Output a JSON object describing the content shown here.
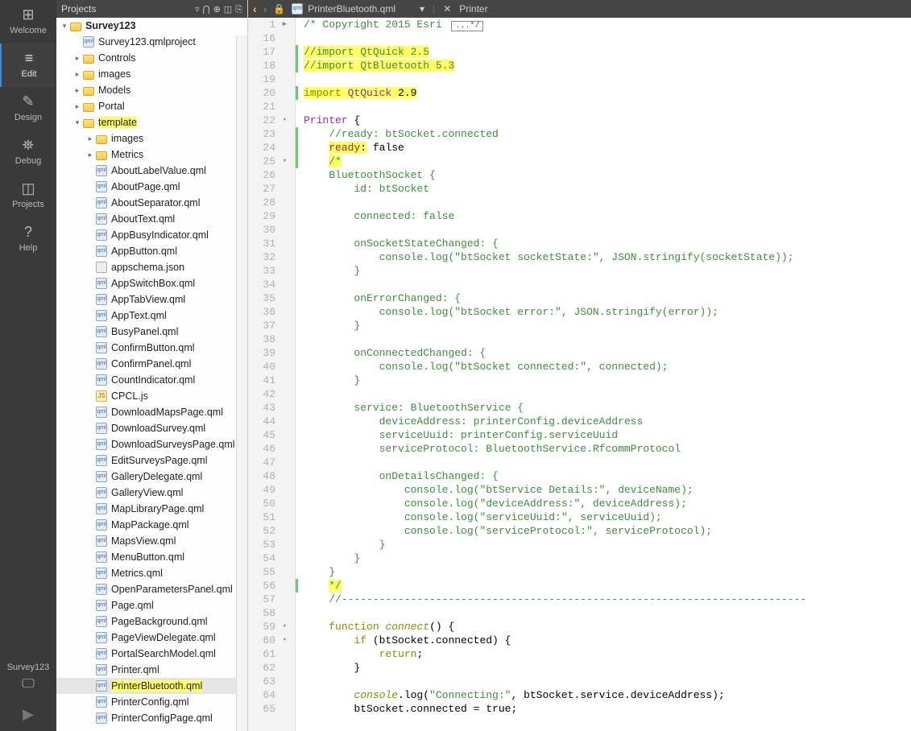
{
  "rail": {
    "items": [
      {
        "icon": "⊞",
        "label": "Welcome"
      },
      {
        "icon": "≡",
        "label": "Edit"
      },
      {
        "icon": "✎",
        "label": "Design"
      },
      {
        "icon": "⛯",
        "label": "Debug"
      },
      {
        "icon": "◫",
        "label": "Projects"
      },
      {
        "icon": "?",
        "label": "Help"
      }
    ],
    "bottom_label": "Survey123",
    "monitor_icon": "🖵",
    "play_icon": "▶"
  },
  "panel": {
    "title": "Projects",
    "toolbar_icons": [
      "▿",
      "⋂",
      "⊕",
      "◫",
      "⎘"
    ]
  },
  "tree": {
    "root": {
      "name": "Survey123",
      "bold": true
    },
    "qmlproject": "Survey123.qmlproject",
    "top_folders": [
      "Controls",
      "images",
      "Models",
      "Portal"
    ],
    "template": "template",
    "template_subfolders": [
      "images",
      "Metrics"
    ],
    "files": [
      "AboutLabelValue.qml",
      "AboutPage.qml",
      "AboutSeparator.qml",
      "AboutText.qml",
      "AppBusyIndicator.qml",
      "AppButton.qml",
      "appschema.json",
      "AppSwitchBox.qml",
      "AppTabView.qml",
      "AppText.qml",
      "BusyPanel.qml",
      "ConfirmButton.qml",
      "ConfirmPanel.qml",
      "CountIndicator.qml",
      "CPCL.js",
      "DownloadMapsPage.qml",
      "DownloadSurvey.qml",
      "DownloadSurveysPage.qml",
      "EditSurveysPage.qml",
      "GalleryDelegate.qml",
      "GalleryView.qml",
      "MapLibraryPage.qml",
      "MapPackage.qml",
      "MapsView.qml",
      "MenuButton.qml",
      "Metrics.qml",
      "OpenParametersPanel.qml",
      "Page.qml",
      "PageBackground.qml",
      "PageViewDelegate.qml",
      "PortalSearchModel.qml",
      "Printer.qml",
      "PrinterBluetooth.qml",
      "PrinterConfig.qml",
      "PrinterConfigPage.qml"
    ],
    "selected_file": "PrinterBluetooth.qml"
  },
  "editor_top": {
    "lock_icon": "🔒",
    "file_icon": "qml",
    "filename": "PrinterBluetooth.qml",
    "dropdown": "▾",
    "x": "✕",
    "breadcrumb": "Printer"
  },
  "code": {
    "start_line": 1,
    "fold_line1_label": "...*/",
    "lines": [
      {
        "n": 1,
        "fold": "▶",
        "html": "<span class='c-comment'>/* Copyright 2015 Esri </span><span class='fold-box'>...*/</span>"
      },
      {
        "n": 16,
        "html": ""
      },
      {
        "n": 17,
        "bar": true,
        "html": "<span class='hl-y'><span class='c-comment'>//import QtQuick 2.5</span></span>"
      },
      {
        "n": 18,
        "bar": true,
        "html": "<span class='hl-y'><span class='c-comment'>//import QtBluetooth 5.3</span></span>"
      },
      {
        "n": 19,
        "html": ""
      },
      {
        "n": 20,
        "bar": true,
        "html": "<span class='hl-y'><span class='c-kw'>import </span><span class='c-type'>QtQuick</span> 2.9</span>"
      },
      {
        "n": 21,
        "html": ""
      },
      {
        "n": 22,
        "fold": "▾",
        "html": "<span class='c-type'>Printer</span> {"
      },
      {
        "n": 23,
        "bar": true,
        "html": "    <span class='c-comment'>//ready: btSocket.connected</span>"
      },
      {
        "n": 24,
        "bar": true,
        "html": "    <span class='hl-y'><span class='c-prop'>ready</span>:</span> false"
      },
      {
        "n": 25,
        "bar": true,
        "fold": "▾",
        "html": "    <span class='hl-y'><span class='c-comment'>/*</span></span>"
      },
      {
        "n": 26,
        "html": "    <span class='c-comment'>BluetoothSocket {</span>"
      },
      {
        "n": 27,
        "html": "        <span class='c-comment'>id: btSocket</span>"
      },
      {
        "n": 28,
        "html": ""
      },
      {
        "n": 29,
        "html": "        <span class='c-comment'>connected: false</span>"
      },
      {
        "n": 30,
        "html": ""
      },
      {
        "n": 31,
        "html": "        <span class='c-comment'>onSocketStateChanged: {</span>"
      },
      {
        "n": 32,
        "html": "            <span class='c-comment'>console.log(\"btSocket socketState:\", JSON.stringify(socketState));</span>"
      },
      {
        "n": 33,
        "html": "        <span class='c-comment'>}</span>"
      },
      {
        "n": 34,
        "html": ""
      },
      {
        "n": 35,
        "html": "        <span class='c-comment'>onErrorChanged: {</span>"
      },
      {
        "n": 36,
        "html": "            <span class='c-comment'>console.log(\"btSocket error:\", JSON.stringify(error));</span>"
      },
      {
        "n": 37,
        "html": "        <span class='c-comment'>}</span>"
      },
      {
        "n": 38,
        "html": ""
      },
      {
        "n": 39,
        "html": "        <span class='c-comment'>onConnectedChanged: {</span>"
      },
      {
        "n": 40,
        "html": "            <span class='c-comment'>console.log(\"btSocket connected:\", connected);</span>"
      },
      {
        "n": 41,
        "html": "        <span class='c-comment'>}</span>"
      },
      {
        "n": 42,
        "html": ""
      },
      {
        "n": 43,
        "html": "        <span class='c-comment'>service: BluetoothService {</span>"
      },
      {
        "n": 44,
        "html": "            <span class='c-comment'>deviceAddress: printerConfig.deviceAddress</span>"
      },
      {
        "n": 45,
        "html": "            <span class='c-comment'>serviceUuid: printerConfig.serviceUuid</span>"
      },
      {
        "n": 46,
        "html": "            <span class='c-comment'>serviceProtocol: BluetoothService.RfcommProtocol</span>"
      },
      {
        "n": 47,
        "html": ""
      },
      {
        "n": 48,
        "html": "            <span class='c-comment'>onDetailsChanged: {</span>"
      },
      {
        "n": 49,
        "html": "                <span class='c-comment'>console.log(\"btService Details:\", deviceName);</span>"
      },
      {
        "n": 50,
        "html": "                <span class='c-comment'>console.log(\"deviceAddress:\", deviceAddress);</span>"
      },
      {
        "n": 51,
        "html": "                <span class='c-comment'>console.log(\"serviceUuid:\", serviceUuid);</span>"
      },
      {
        "n": 52,
        "html": "                <span class='c-comment'>console.log(\"serviceProtocol:\", serviceProtocol);</span>"
      },
      {
        "n": 53,
        "html": "            <span class='c-comment'>}</span>"
      },
      {
        "n": 54,
        "html": "        <span class='c-comment'>}</span>"
      },
      {
        "n": 55,
        "html": "    <span class='c-comment'>}</span>"
      },
      {
        "n": 56,
        "bar": true,
        "html": "    <span class='hl-y'><span class='c-comment'>*/</span></span>"
      },
      {
        "n": 57,
        "html": "    <span class='c-comment'>//--------------------------------------------------------------------------</span>"
      },
      {
        "n": 58,
        "html": ""
      },
      {
        "n": 59,
        "fold": "▾",
        "html": "    <span class='c-kw'>function</span> <span class='c-kw2'>connect</span>() {"
      },
      {
        "n": 60,
        "fold": "▾",
        "html": "        <span class='c-kw'>if</span> (btSocket.connected) {"
      },
      {
        "n": 61,
        "html": "            <span class='c-kw'>return</span>;"
      },
      {
        "n": 62,
        "html": "        }"
      },
      {
        "n": 63,
        "html": ""
      },
      {
        "n": 64,
        "html": "        <span class='c-kw2'>console</span>.log(<span class='c-str'>\"Connecting:\"</span>, btSocket.service.deviceAddress);"
      },
      {
        "n": 65,
        "html": "        btSocket.connected = true;"
      }
    ]
  }
}
